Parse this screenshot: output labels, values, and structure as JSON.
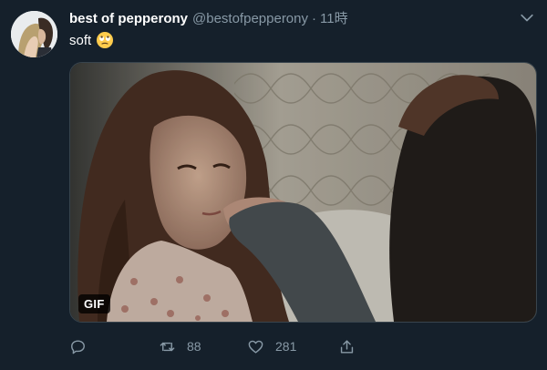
{
  "tweet": {
    "display_name": "best of pepperony",
    "handle": "@bestofpepperony",
    "separator": "·",
    "time": "11時",
    "text": "soft",
    "emoji": "face-with-rolling-eyes-emoji",
    "media": {
      "badge": "GIF"
    },
    "actions": {
      "reply_count": "",
      "retweet_count": "88",
      "like_count": "281"
    }
  },
  "colors": {
    "background": "#15202b",
    "text_primary": "#ffffff",
    "text_secondary": "#8899a6",
    "accent": "#1da1f2"
  }
}
